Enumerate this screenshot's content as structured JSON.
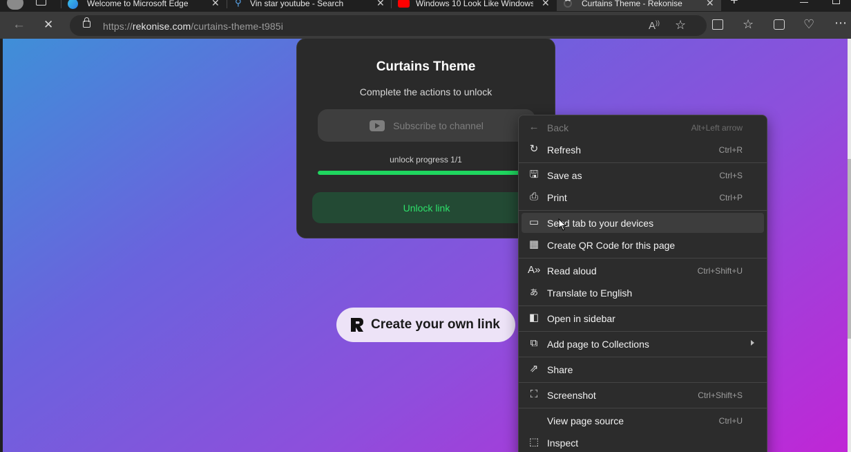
{
  "tabs": [
    {
      "title": "Welcome to Microsoft Edge",
      "icon": "edge-icon"
    },
    {
      "title": "Vin star youtube - Search",
      "icon": "search-icon"
    },
    {
      "title": "Windows 10 Look Like Windows",
      "icon": "youtube-icon"
    },
    {
      "title": "Curtains Theme - Rekonise",
      "icon": "loading-icon"
    }
  ],
  "address": {
    "scheme": "https://",
    "host": "rekonise.com",
    "path": "/curtains-theme-t985i"
  },
  "card": {
    "title": "Curtains Theme",
    "subtitle": "Complete the actions to unlock",
    "subscribe_label": "Subscribe to channel",
    "progress_label": "unlock progress 1/1",
    "progress_fraction": 1.0,
    "unlock_label": "Unlock link"
  },
  "create_link": {
    "label": "Create your own link"
  },
  "context_menu": {
    "items": [
      {
        "label": "Back",
        "shortcut": "Alt+Left arrow",
        "icon": "back-arrow-icon",
        "disabled": true
      },
      {
        "label": "Refresh",
        "shortcut": "Ctrl+R",
        "icon": "refresh-icon"
      },
      {
        "label": "Save as",
        "shortcut": "Ctrl+S",
        "icon": "save-icon"
      },
      {
        "label": "Print",
        "shortcut": "Ctrl+P",
        "icon": "print-icon"
      },
      {
        "label": "Send tab to your devices",
        "shortcut": "",
        "icon": "send-tab-icon",
        "hover": true
      },
      {
        "label": "Create QR Code for this page",
        "shortcut": "",
        "icon": "qr-code-icon"
      },
      {
        "label": "Read aloud",
        "shortcut": "Ctrl+Shift+U",
        "icon": "read-aloud-icon"
      },
      {
        "label": "Translate to English",
        "shortcut": "",
        "icon": "translate-icon"
      },
      {
        "label": "Open in sidebar",
        "shortcut": "",
        "icon": "sidebar-icon"
      },
      {
        "label": "Add page to Collections",
        "shortcut": "",
        "icon": "collections-icon",
        "submenu": true
      },
      {
        "label": "Share",
        "shortcut": "",
        "icon": "share-icon"
      },
      {
        "label": "Screenshot",
        "shortcut": "Ctrl+Shift+S",
        "icon": "screenshot-icon"
      },
      {
        "label": "View page source",
        "shortcut": "Ctrl+U",
        "icon": ""
      },
      {
        "label": "Inspect",
        "shortcut": "",
        "icon": "inspect-icon"
      }
    ]
  }
}
